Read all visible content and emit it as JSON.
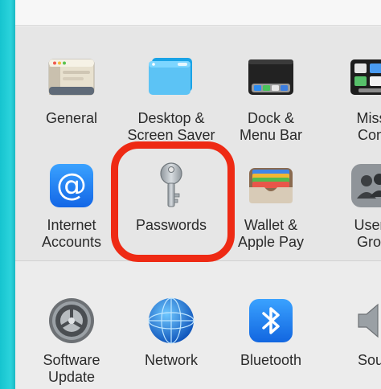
{
  "panes_row1": [
    {
      "id": "general",
      "label": "General",
      "icon": "general-icon"
    },
    {
      "id": "desktop",
      "label": "Desktop &\nScreen Saver",
      "icon": "desktop-screen-saver-icon"
    },
    {
      "id": "dock",
      "label": "Dock &\nMenu Bar",
      "icon": "dock-menu-bar-icon"
    },
    {
      "id": "mission",
      "label": "Missi\nCont",
      "icon": "mission-control-icon"
    }
  ],
  "panes_row2": [
    {
      "id": "internet",
      "label": "Internet\nAccounts",
      "icon": "internet-accounts-icon",
      "glyph": "@"
    },
    {
      "id": "passwords",
      "label": "Passwords",
      "icon": "key-icon"
    },
    {
      "id": "wallet",
      "label": "Wallet &\nApple Pay",
      "icon": "wallet-icon"
    },
    {
      "id": "users",
      "label": "Users\nGrou",
      "icon": "users-groups-icon"
    }
  ],
  "panes_row3": [
    {
      "id": "software",
      "label": "Software\nUpdate",
      "icon": "software-update-gear-icon"
    },
    {
      "id": "network",
      "label": "Network",
      "icon": "network-globe-icon"
    },
    {
      "id": "bluetooth",
      "label": "Bluetooth",
      "icon": "bluetooth-icon"
    },
    {
      "id": "sound",
      "label": "Sour",
      "icon": "speaker-icon"
    }
  ],
  "colors": {
    "highlight": "#ee2a14",
    "accent_blue": "#1e7cf2"
  }
}
